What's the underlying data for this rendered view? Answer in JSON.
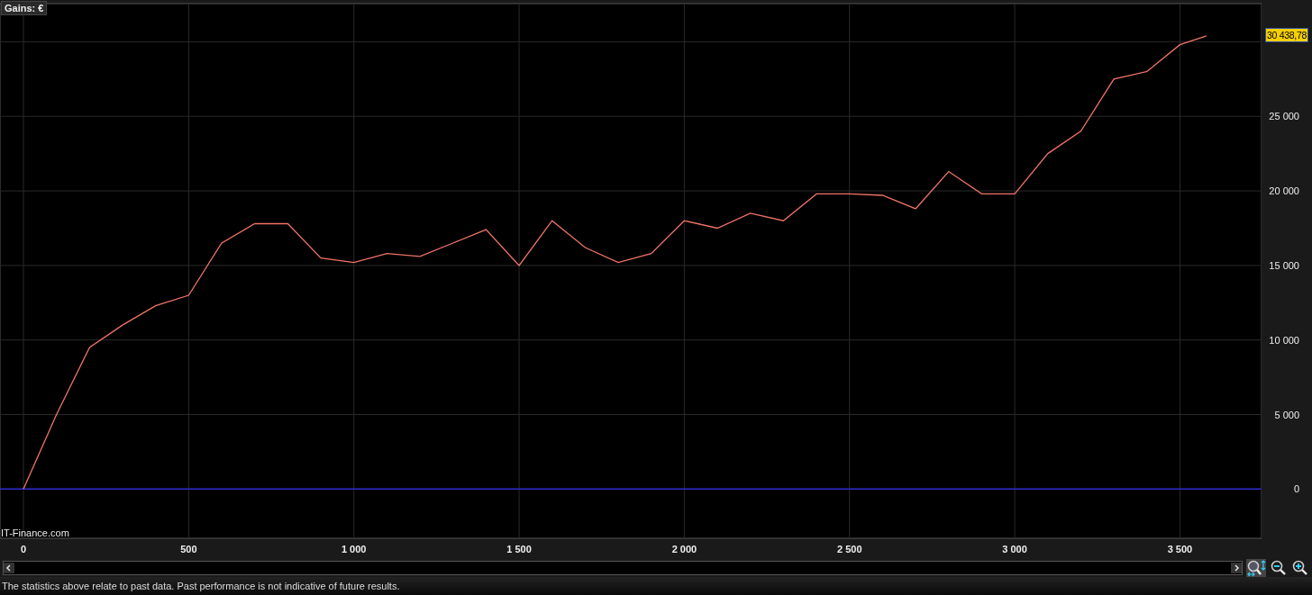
{
  "chart": {
    "label": "Gains: €",
    "last_value": "30 438,78",
    "credit": "IT-Finance.com",
    "chart_data": {
      "type": "line",
      "x": [
        0,
        100,
        200,
        300,
        400,
        500,
        600,
        700,
        800,
        900,
        1000,
        1100,
        1200,
        1300,
        1400,
        1500,
        1600,
        1700,
        1800,
        1900,
        2000,
        2100,
        2200,
        2300,
        2400,
        2500,
        2600,
        2700,
        2800,
        2900,
        3000,
        3100,
        3200,
        3300,
        3400,
        3500,
        3580
      ],
      "grid": true,
      "series": [
        {
          "color": "#f07468",
          "values": [
            0,
            5000,
            9500,
            11000,
            12300,
            13000,
            16500,
            17800,
            17800,
            15500,
            15200,
            15800,
            15600,
            16500,
            17400,
            15000,
            18000,
            16200,
            15200,
            15800,
            18000,
            17500,
            18500,
            18000,
            19800,
            19800,
            19700,
            18800,
            21300,
            19800,
            19800,
            22500,
            24000,
            27500,
            28000,
            29800,
            30400
          ]
        }
      ],
      "xlim": [
        -71,
        3747
      ],
      "ylim": [
        -3300,
        32560
      ],
      "xticks": [
        {
          "value": 0,
          "label": "0"
        },
        {
          "value": 500,
          "label": "500"
        },
        {
          "value": 1000,
          "label": "1 000"
        },
        {
          "value": 1500,
          "label": "1 500"
        },
        {
          "value": 2000,
          "label": "2 000"
        },
        {
          "value": 2500,
          "label": "2 500"
        },
        {
          "value": 3000,
          "label": "3 000"
        },
        {
          "value": 3500,
          "label": "3 500"
        }
      ],
      "yticks": [
        {
          "value": 0,
          "label": "0"
        },
        {
          "value": 5000,
          "label": "5 000"
        },
        {
          "value": 10000,
          "label": "10 000"
        },
        {
          "value": 15000,
          "label": "15 000"
        },
        {
          "value": 20000,
          "label": "20 000"
        },
        {
          "value": 25000,
          "label": "25 000"
        }
      ],
      "ref_lines": [
        {
          "axis": "y",
          "value": 0,
          "color": "#2a2ad0"
        }
      ]
    }
  },
  "status_bar": {
    "text": "The statistics above relate to past data. Past performance is not indicative of future results."
  }
}
